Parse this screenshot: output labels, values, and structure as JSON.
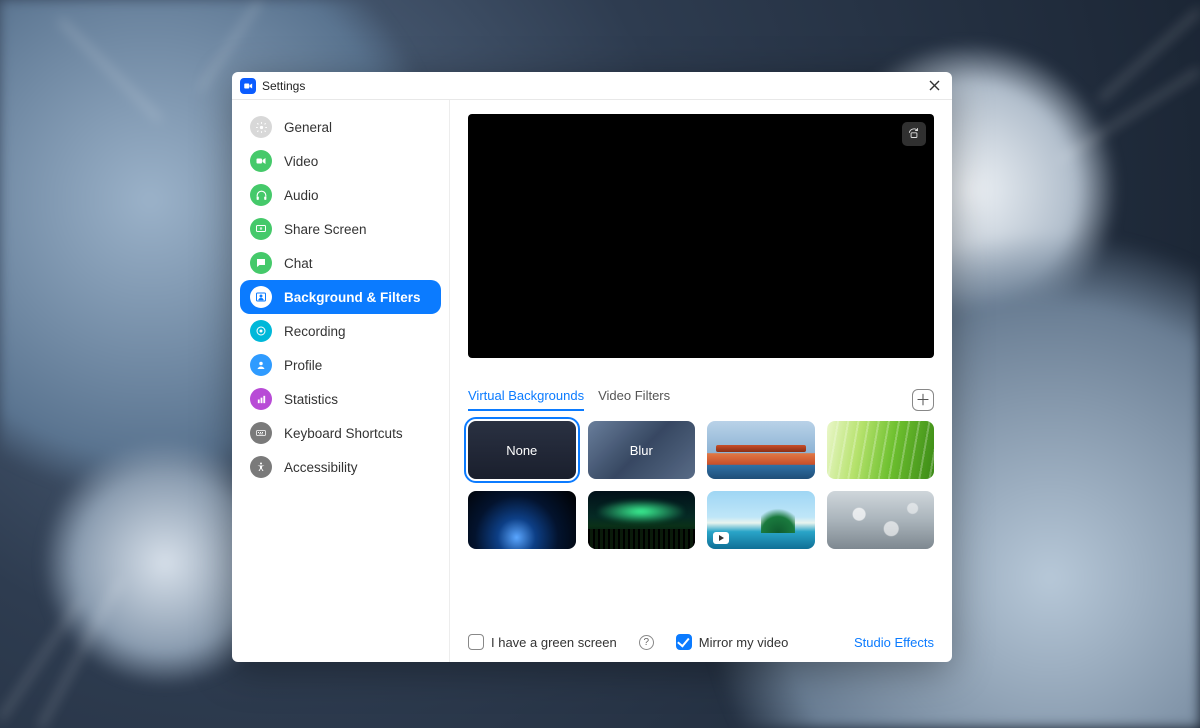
{
  "window": {
    "title": "Settings"
  },
  "sidebar": {
    "items": [
      {
        "label": "General"
      },
      {
        "label": "Video"
      },
      {
        "label": "Audio"
      },
      {
        "label": "Share Screen"
      },
      {
        "label": "Chat"
      },
      {
        "label": "Background & Filters"
      },
      {
        "label": "Recording"
      },
      {
        "label": "Profile"
      },
      {
        "label": "Statistics"
      },
      {
        "label": "Keyboard Shortcuts"
      },
      {
        "label": "Accessibility"
      }
    ],
    "active_index": 5
  },
  "main": {
    "tabs": {
      "virtual_backgrounds": "Virtual Backgrounds",
      "video_filters": "Video Filters",
      "active": "virtual_backgrounds"
    },
    "thumbs": {
      "none": "None",
      "blur": "Blur"
    },
    "footer": {
      "green_screen_label": "I have a green screen",
      "mirror_label": "Mirror my video",
      "studio_label": "Studio Effects",
      "green_screen_checked": false,
      "mirror_checked": true
    }
  }
}
